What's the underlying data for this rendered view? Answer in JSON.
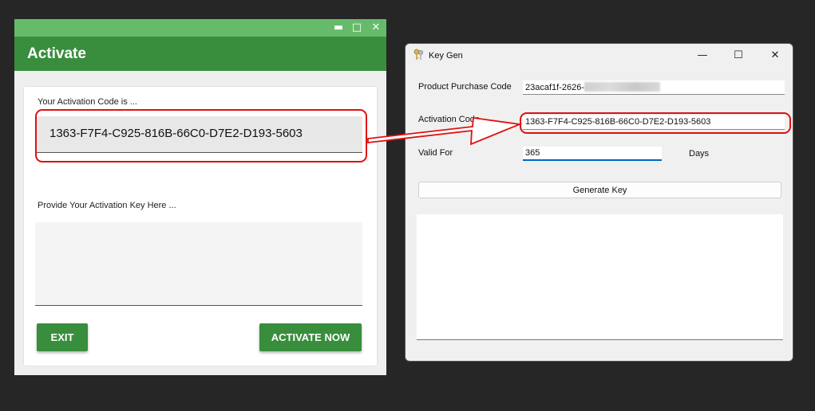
{
  "activate_window": {
    "title": "Activate",
    "controls": {
      "minimize": "▬",
      "maximize": "□",
      "close": "✕"
    },
    "code_label": "Your Activation Code is ...",
    "activation_code": "1363-F7F4-C925-816B-66C0-D7E2-D193-5603",
    "key_label": "Provide Your Activation Key Here ...",
    "key_value": "",
    "exit_label": "EXIT",
    "activate_label": "ACTIVATE NOW"
  },
  "keygen_window": {
    "title": "Key Gen",
    "controls": {
      "minimize": "—",
      "maximize": "☐",
      "close": "✕"
    },
    "product_label": "Product Purchase Code",
    "product_value": "23acaf1f-2626-",
    "activation_label": "Activation Code",
    "activation_value": "1363-F7F4-C925-816B-66C0-D7E2-D193-5603",
    "valid_label": "Valid For",
    "valid_value": "365",
    "days_label": "Days",
    "generate_label": "Generate Key",
    "output_value": ""
  },
  "colors": {
    "green_dark": "#388e3c",
    "green_light": "#66bb6a",
    "annotation_red": "#e01010",
    "focus_blue": "#0067c0"
  }
}
